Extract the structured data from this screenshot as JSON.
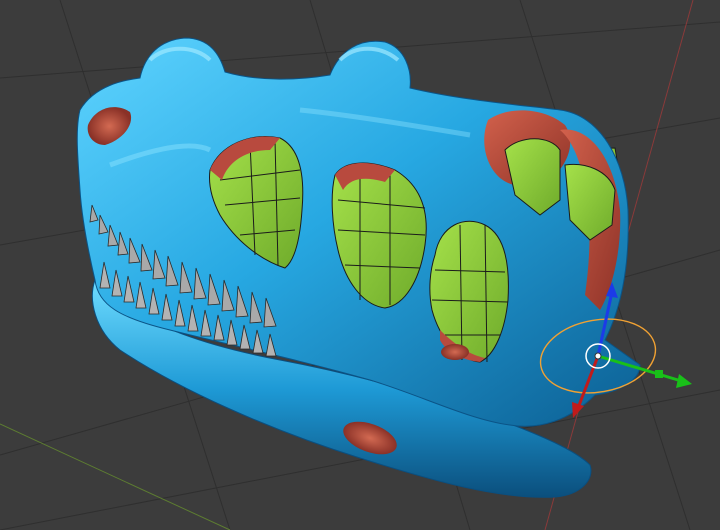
{
  "viewport": {
    "background": "#3c3c3c",
    "grid_color": "#2e2e2e",
    "x_axis_color": "#8a3a3a",
    "y_axis_color": "#5d7d31"
  },
  "model": {
    "skull_color": "#27a8e2",
    "skull_highlight": "#68d8ff",
    "skull_shadow": "#0a5a8a",
    "interior_color": "#b84a3e",
    "inner_mesh_color": "#8ac93a",
    "teeth_color": "#a7a7a7",
    "wire_color": "#1b1b1b"
  },
  "gizmo": {
    "x_color": "#19c019",
    "y_color": "#c01b1b",
    "z_color": "#1c3be8",
    "ring_color": "#f0a133",
    "pivot_color": "#ffffff"
  }
}
